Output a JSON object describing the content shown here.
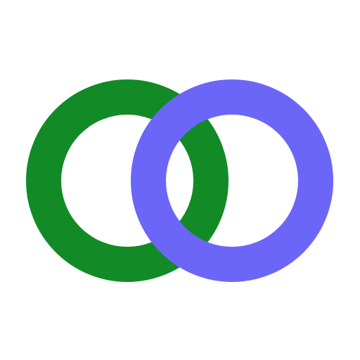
{
  "logo": {
    "colors": {
      "background": "#ffffff",
      "left_ring": "#128a26",
      "right_ring": "#6b66f7"
    },
    "icon": "interlocking-rings-icon"
  }
}
